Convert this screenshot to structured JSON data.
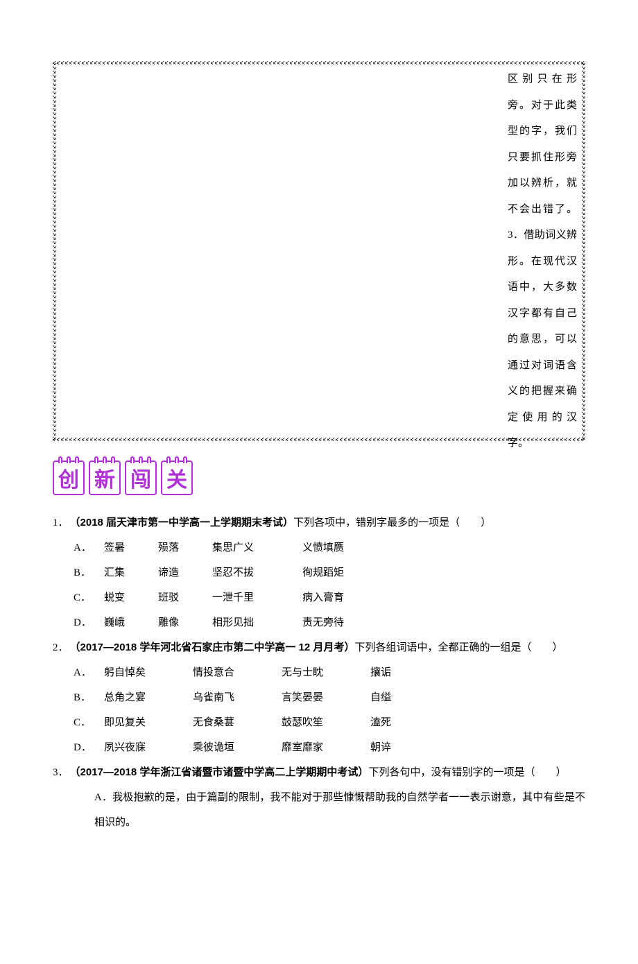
{
  "sidebar_note": "区别只在形旁。对于此类型的字，我们只要抓住形旁加以辨析，就不会出错了。3．借助词义辨形。在现代汉语中，大多数汉字都有自己的意思，可以通过对词语含义的把握来确定使用的汉字。",
  "heading": [
    "创",
    "新",
    "闯",
    "关"
  ],
  "q1": {
    "num": "1．",
    "source": "（2018 届天津市第一中学高一上学期期末考试）",
    "stem": "下列各项中，错别字最多的一项是（　　）",
    "opts": [
      {
        "l": "A．",
        "w": [
          "签暑",
          "殒落",
          "集思广义",
          "义愤填赝"
        ]
      },
      {
        "l": "B．",
        "w": [
          "汇集",
          "谛造",
          "坚忍不拔",
          "徇规蹈矩"
        ]
      },
      {
        "l": "C．",
        "w": [
          "蜕变",
          "班驳",
          "一泄千里",
          "病入膏育"
        ]
      },
      {
        "l": "D．",
        "w": [
          "巍峨",
          "雕像",
          "相形见拙",
          "责无旁待"
        ]
      }
    ]
  },
  "q2": {
    "num": "2．",
    "source": "（2017—2018 学年河北省石家庄市第二中学高一 12 月月考）",
    "stem": "下列各组词语中，全都正确的一组是（　　）",
    "opts": [
      {
        "l": "A．",
        "w": [
          "躬自悼矣",
          "情投意合",
          "无与士眈",
          "攘诟"
        ]
      },
      {
        "l": "B．",
        "w": [
          "总角之宴",
          "乌雀南飞",
          "言笑晏晏",
          "自缢"
        ]
      },
      {
        "l": "C．",
        "w": [
          "即见复关",
          "无食桑葚",
          "鼓瑟吹笙",
          "溘死"
        ]
      },
      {
        "l": "D．",
        "w": [
          "夙兴夜寐",
          "乘彼诡垣",
          "靡室靡家",
          "朝谇"
        ]
      }
    ]
  },
  "q3": {
    "num": "3．",
    "source": "（2017—2018 学年浙江省诸暨市诸暨中学高二上学期期中考试）",
    "stem": "下列各句中，没有错别字的一项是（　　）",
    "optA_label": "A．",
    "optA_text": "我极抱歉的是，由于篇副的限制，我不能对于那些慷慨帮助我的自然学者一一表示谢意，其中有些是不相识的。"
  }
}
